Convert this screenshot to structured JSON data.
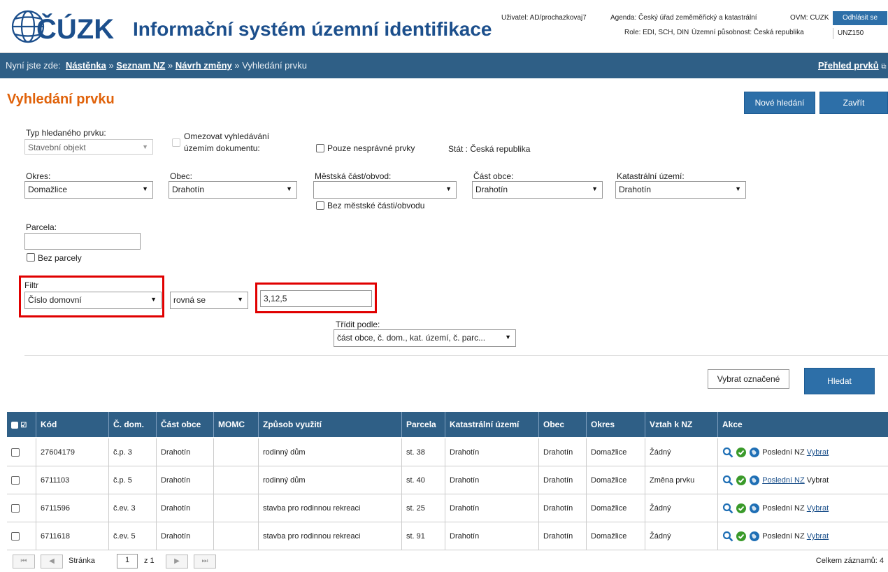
{
  "header": {
    "logo_text": "ČÚZK",
    "app_title": "Informační systém územní identifikace",
    "user": "Uživatel: AD/prochazkovaj7",
    "agenda": "Agenda: Český úřad zeměměřický a katastrální",
    "ovm": "OVM: CUZK",
    "role": "Role: EDI, SCH, DIN",
    "scope": "Územní působnost: Česká republika",
    "logout_label": "Odhlásit se",
    "unz": "UNZ150"
  },
  "nav": {
    "prefix": "Nyní jste zde:",
    "crumbs": [
      "Nástěnka",
      "Seznam NZ",
      "Návrh změny"
    ],
    "current": "Vyhledání prvku",
    "overview_link": "Přehled prvků"
  },
  "page": {
    "title": "Vyhledání prvku",
    "new_search_label": "Nové hledání",
    "close_label": "Zavřít"
  },
  "form": {
    "type_label": "Typ hledaného prvku:",
    "type_value": "Stavební objekt",
    "limit_label_1": "Omezovat vyhledávání",
    "limit_label_2": "územím dokumentu:",
    "only_incorrect_label": "Pouze nesprávné prvky",
    "state_label": "Stát : Česká republika",
    "okres_label": "Okres:",
    "okres_value": "Domažlice",
    "obec_label": "Obec:",
    "obec_value": "Drahotín",
    "mestska_label": "Městská část/obvod:",
    "mestska_value": "",
    "bez_mestske_label": "Bez městské části/obvodu",
    "cast_obce_label": "Část obce:",
    "cast_obce_value": "Drahotín",
    "kat_uzemi_label": "Katastrální území:",
    "kat_uzemi_value": "Drahotín",
    "parcela_label": "Parcela:",
    "parcela_value": "",
    "bez_parcely_label": "Bez parcely",
    "filtr_label": "Filtr",
    "filtr_field": "Číslo domovní",
    "filtr_operator": "rovná se",
    "filtr_value": "3,12,5",
    "sort_label": "Třídit podle:",
    "sort_value": "část obce, č. dom., kat. území, č. parc...",
    "select_marked_label": "Vybrat označené",
    "search_label": "Hledat"
  },
  "table": {
    "headers": [
      "Kód",
      "Č. dom.",
      "Část obce",
      "MOMC",
      "Způsob využití",
      "Parcela",
      "Katastrální území",
      "Obec",
      "Okres",
      "Vztah k NZ",
      "Akce"
    ],
    "rows": [
      {
        "kod": "27604179",
        "cdom": "č.p. 3",
        "cast_obce": "Drahotín",
        "momc": "",
        "vyuziti": "rodinný dům",
        "parcela": "st. 38",
        "kat": "Drahotín",
        "obec": "Drahotín",
        "okres": "Domažlice",
        "vztah": "Žádný",
        "posledni": "Poslední NZ",
        "vybrat": "Vybrat"
      },
      {
        "kod": "6711103",
        "cdom": "č.p. 5",
        "cast_obce": "Drahotín",
        "momc": "",
        "vyuziti": "rodinný dům",
        "parcela": "st. 40",
        "kat": "Drahotín",
        "obec": "Drahotín",
        "okres": "Domažlice",
        "vztah": "Změna prvku",
        "posledni": "Poslední NZ",
        "vybrat": "Vybrat"
      },
      {
        "kod": "6711596",
        "cdom": "č.ev. 3",
        "cast_obce": "Drahotín",
        "momc": "",
        "vyuziti": "stavba pro rodinnou rekreaci",
        "parcela": "st. 25",
        "kat": "Drahotín",
        "obec": "Drahotín",
        "okres": "Domažlice",
        "vztah": "Žádný",
        "posledni": "Poslední NZ",
        "vybrat": "Vybrat"
      },
      {
        "kod": "6711618",
        "cdom": "č.ev. 5",
        "cast_obce": "Drahotín",
        "momc": "",
        "vyuziti": "stavba pro rodinnou rekreaci",
        "parcela": "st. 91",
        "kat": "Drahotín",
        "obec": "Drahotín",
        "okres": "Domažlice",
        "vztah": "Žádný",
        "posledni": "Poslední NZ",
        "vybrat": "Vybrat"
      }
    ]
  },
  "pager": {
    "page_label": "Stránka",
    "page_value": "1",
    "of_label": "z 1",
    "total": "Celkem záznamů: 4"
  },
  "colors": {
    "brand_blue": "#1c4f8c",
    "nav_bar": "#2f5f86",
    "title_orange": "#e0620a",
    "highlight_red": "#e00000"
  }
}
